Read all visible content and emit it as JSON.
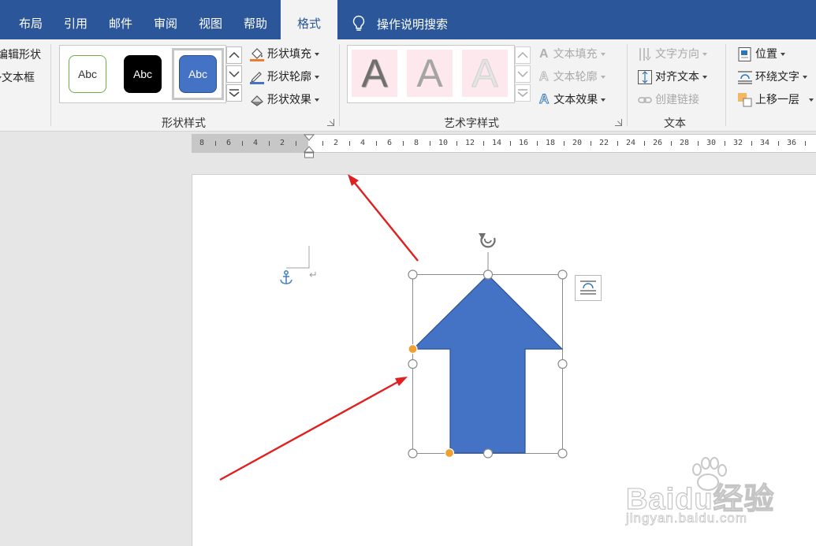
{
  "tabs": [
    {
      "label": "布局",
      "active": false
    },
    {
      "label": "引用",
      "active": false
    },
    {
      "label": "邮件",
      "active": false
    },
    {
      "label": "审阅",
      "active": false
    },
    {
      "label": "视图",
      "active": false
    },
    {
      "label": "帮助",
      "active": false
    },
    {
      "label": "格式",
      "active": true
    }
  ],
  "tell_me": {
    "label": "操作说明搜索"
  },
  "ribbon": {
    "insert_shape": {
      "edit_shape": "编辑形状",
      "textbox": "文本框"
    },
    "shape_styles": {
      "group_label": "形状样式",
      "gallery": [
        "Abc",
        "Abc",
        "Abc"
      ],
      "fill": "形状填充",
      "outline": "形状轮廓",
      "effects": "形状效果"
    },
    "wordart_styles": {
      "group_label": "艺术字样式",
      "gallery": [
        "A",
        "A",
        "A"
      ],
      "text_fill": "文本填充",
      "text_outline": "文本轮廓",
      "text_effects": "文本效果"
    },
    "text": {
      "group_label": "文本",
      "direction": "文字方向",
      "align": "对齐文本",
      "link": "创建链接"
    },
    "arrange": {
      "position": "位置",
      "wrap": "环绕文字",
      "bring_forward": "上移一层"
    }
  },
  "ruler": {
    "labels": [
      "8",
      "6",
      "4",
      "2",
      "2",
      "4",
      "6",
      "8",
      "10",
      "12",
      "14",
      "16",
      "18",
      "20",
      "22",
      "24",
      "26",
      "28",
      "30",
      "32",
      "34",
      "36"
    ]
  },
  "document": {
    "paragraph_mark": "↵",
    "shape": {
      "type": "up-arrow",
      "fill": "#4472c4",
      "outline": "#2f528f"
    }
  },
  "watermark": {
    "brand": "Baidu经验",
    "url": "jingyan.baidu.com"
  },
  "colors": {
    "accent": "#2b579a",
    "annotation": "#e02020",
    "handle_yellow": "#f0a030"
  }
}
